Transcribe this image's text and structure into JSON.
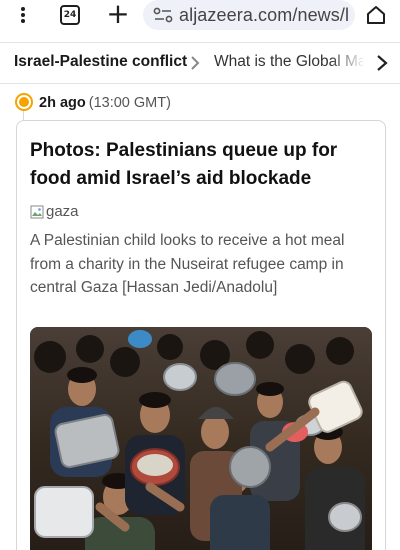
{
  "browser": {
    "tab_count": "24",
    "url": "aljazeera.com/news/l",
    "icons": {
      "menu": "kebab-menu-icon",
      "tabs": "tab-switcher-icon",
      "new_tab": "plus-icon",
      "site_info": "site-settings-icon",
      "home": "home-icon"
    }
  },
  "breadcrumb": {
    "current": "Israel-Palestine conflict",
    "next": "What is the Global Marc"
  },
  "update": {
    "time_ago": "2h ago",
    "time_abs": "(13:00 GMT)",
    "accent_color": "#f4a300"
  },
  "article": {
    "headline": "Photos: Palestinians queue up for food amid Israel’s aid blockade",
    "image_alt": "gaza",
    "caption": "A Palestinian child looks to receive a hot meal from a charity in the Nuseirat refugee camp in central Gaza [Hassan Jedi/Anadolu]"
  }
}
